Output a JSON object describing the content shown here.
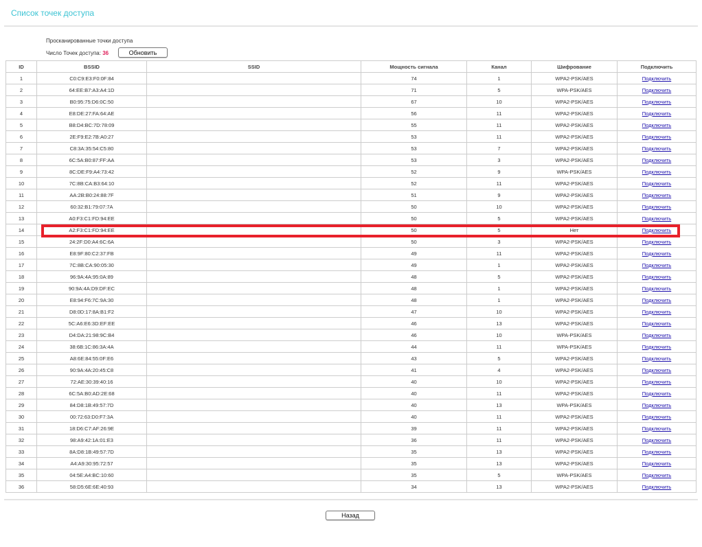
{
  "page": {
    "title": "Список точек доступа",
    "scanned_label": "Просканированные точки доступа",
    "count_label": "Число Точек доступа:",
    "count": "36",
    "refresh_label": "Обновить",
    "back_label": "Назад"
  },
  "table": {
    "headers": [
      "ID",
      "BSSID",
      "SSID",
      "Мощность сигнала",
      "Канал",
      "Шифрование",
      "Подключить"
    ],
    "connect_label": "Подключить",
    "highlighted_id": "14",
    "rows": [
      [
        "1",
        "C0:C9:E3:F0:0F:84",
        "",
        "74",
        "1",
        "WPA2-PSK/AES"
      ],
      [
        "2",
        "64:EE:B7:A3:A4:1D",
        "",
        "71",
        "5",
        "WPA-PSK/AES"
      ],
      [
        "3",
        "B0:95:75:D6:0C:50",
        "",
        "67",
        "10",
        "WPA2-PSK/AES"
      ],
      [
        "4",
        "E8:DE:27:FA:64:AE",
        "",
        "56",
        "11",
        "WPA2-PSK/AES"
      ],
      [
        "5",
        "B8:D4:BC:7D:78:09",
        "",
        "55",
        "11",
        "WPA2-PSK/AES"
      ],
      [
        "6",
        "2E:F9:E2:7B:A0:27",
        "",
        "53",
        "11",
        "WPA2-PSK/AES"
      ],
      [
        "7",
        "C8:3A:35:54:C5:80",
        "",
        "53",
        "7",
        "WPA2-PSK/AES"
      ],
      [
        "8",
        "6C:5A:B0:87:FF:AA",
        "",
        "53",
        "3",
        "WPA2-PSK/AES"
      ],
      [
        "9",
        "8C:DE:F9:A4:73:42",
        "",
        "52",
        "9",
        "WPA-PSK/AES"
      ],
      [
        "10",
        "7C:8B:CA:B3:64:10",
        "",
        "52",
        "11",
        "WPA2-PSK/AES"
      ],
      [
        "11",
        "AA:2B:B0:24:88:7F",
        "",
        "51",
        "9",
        "WPA2-PSK/AES"
      ],
      [
        "12",
        "60:32:B1:79:07:7A",
        "",
        "50",
        "10",
        "WPA2-PSK/AES"
      ],
      [
        "13",
        "A0:F3:C1:FD:94:EE",
        "",
        "50",
        "5",
        "WPA2-PSK/AES"
      ],
      [
        "14",
        "A2:F3:C1:FD:94:EE",
        "",
        "50",
        "5",
        "Нет"
      ],
      [
        "15",
        "24:2F:D0:A4:6C:6A",
        "",
        "50",
        "3",
        "WPA2-PSK/AES"
      ],
      [
        "16",
        "E8:9F:80:C2:37:FB",
        "",
        "49",
        "11",
        "WPA2-PSK/AES"
      ],
      [
        "17",
        "7C:8B:CA:90:05:30",
        "",
        "49",
        "1",
        "WPA2-PSK/AES"
      ],
      [
        "18",
        "96:9A:4A:95:0A:89",
        "",
        "48",
        "5",
        "WPA2-PSK/AES"
      ],
      [
        "19",
        "90:9A:4A:D9:DF:EC",
        "",
        "48",
        "1",
        "WPA2-PSK/AES"
      ],
      [
        "20",
        "E8:94:F6:7C:9A:30",
        "",
        "48",
        "1",
        "WPA2-PSK/AES"
      ],
      [
        "21",
        "D8:0D:17:8A:B1:F2",
        "",
        "47",
        "10",
        "WPA2-PSK/AES"
      ],
      [
        "22",
        "5C:A6:E6:3D:EF:EE",
        "",
        "46",
        "13",
        "WPA2-PSK/AES"
      ],
      [
        "23",
        "D4:DA:21:98:9C:B4",
        "",
        "46",
        "10",
        "WPA-PSK/AES"
      ],
      [
        "24",
        "38:6B:1C:86:3A:4A",
        "",
        "44",
        "11",
        "WPA-PSK/AES"
      ],
      [
        "25",
        "A8:6E:84:55:0F:E6",
        "",
        "43",
        "5",
        "WPA2-PSK/AES"
      ],
      [
        "26",
        "90:9A:4A:20:45:C8",
        "",
        "41",
        "4",
        "WPA2-PSK/AES"
      ],
      [
        "27",
        "72:AE:30:39:40:16",
        "",
        "40",
        "10",
        "WPA2-PSK/AES"
      ],
      [
        "28",
        "6C:5A:B0:AD:2E:68",
        "",
        "40",
        "11",
        "WPA2-PSK/AES"
      ],
      [
        "29",
        "84:D8:1B:49:57:7D",
        "",
        "40",
        "13",
        "WPA-PSK/AES"
      ],
      [
        "30",
        "00:72:63:D0:F7:3A",
        "",
        "40",
        "11",
        "WPA2-PSK/AES"
      ],
      [
        "31",
        "18:D6:C7:AF:26:9E",
        "",
        "39",
        "11",
        "WPA2-PSK/AES"
      ],
      [
        "32",
        "98:A9:42:1A:01:E3",
        "",
        "36",
        "11",
        "WPA2-PSK/AES"
      ],
      [
        "33",
        "8A:D8:1B:49:57:7D",
        "",
        "35",
        "13",
        "WPA2-PSK/AES"
      ],
      [
        "34",
        "A4:A9:30:95:72:57",
        "",
        "35",
        "13",
        "WPA2-PSK/AES"
      ],
      [
        "35",
        "04:5E:A4:BC:10:60",
        "",
        "35",
        "5",
        "WPA-PSK/AES"
      ],
      [
        "36",
        "58:D5:6E:6E:40:93",
        "",
        "34",
        "13",
        "WPA2-PSK/AES"
      ]
    ]
  }
}
